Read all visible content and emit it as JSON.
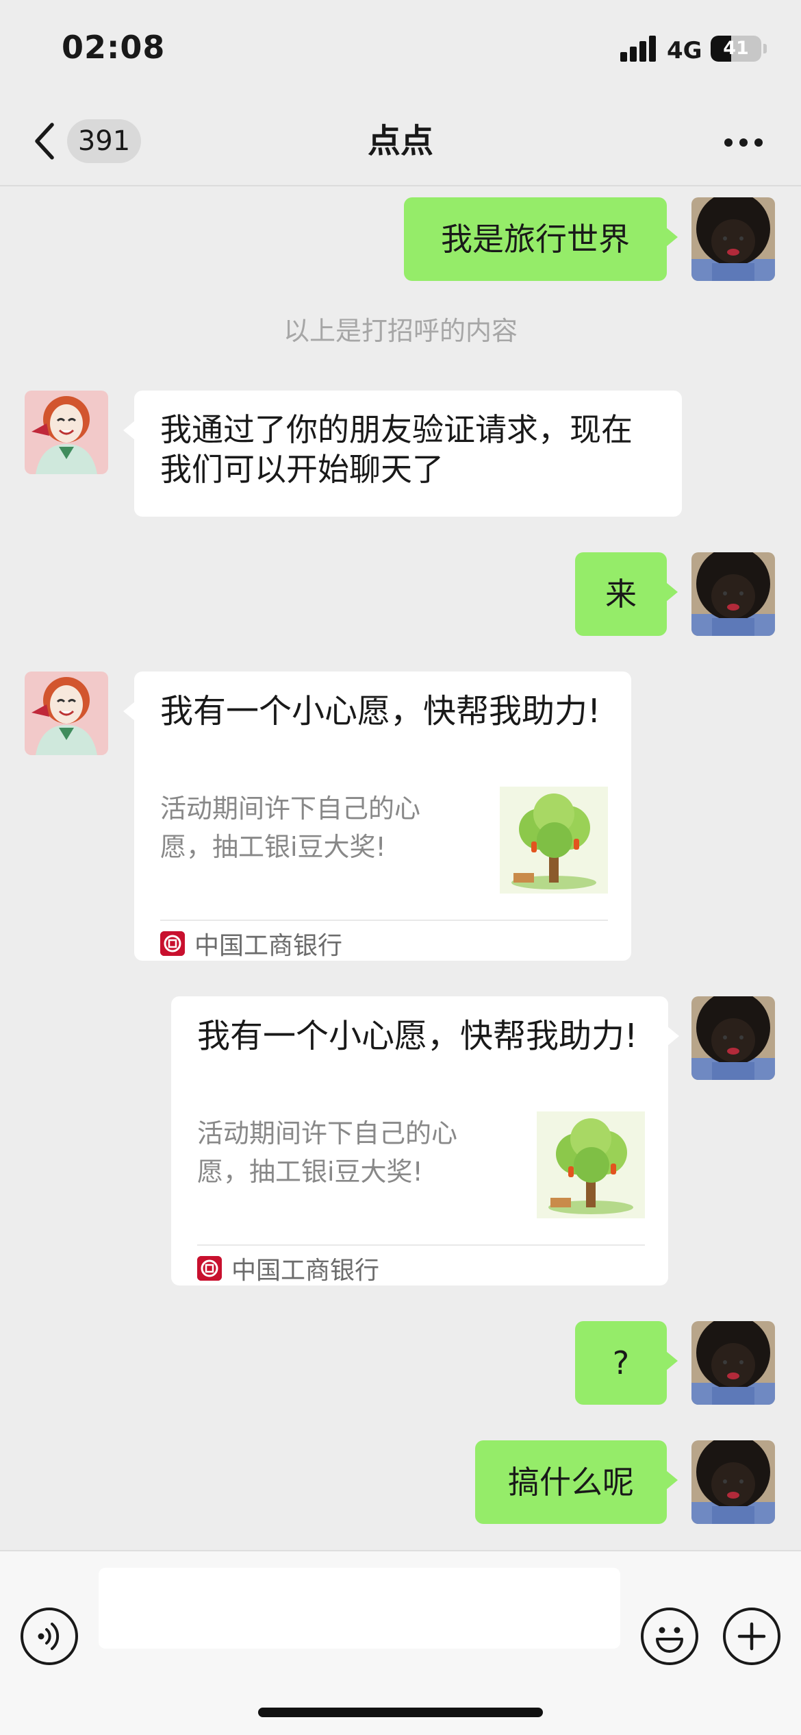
{
  "status_bar": {
    "time": "02:08",
    "network": "4G",
    "battery": "41",
    "battery_level": 0.41
  },
  "nav": {
    "unread_count": "391",
    "title": "点点"
  },
  "messages": {
    "m1": "我是旅行世界",
    "system_note": "以上是打招呼的内容",
    "m2": "我通过了你的朋友验证请求，现在我们可以开始聊天了",
    "m3": "来",
    "card1": {
      "title": "我有一个小心愿，快帮我助力!",
      "desc": "活动期间许下自己的心愿，抽工银i豆大奖!",
      "source": "中国工商银行"
    },
    "card2": {
      "title": "我有一个小心愿，快帮我助力!",
      "desc": "活动期间许下自己的心愿，抽工银i豆大奖!",
      "source": "中国工商银行"
    },
    "m4": "?",
    "m5": "搞什么呢"
  },
  "icons": {
    "back": "chevron-left-icon",
    "more": "more-dots-icon",
    "voice": "voice-icon",
    "emoji": "emoji-icon",
    "plus": "plus-icon",
    "card_thumbnail": "wish-tree-image",
    "card_source": "icbc-logo-icon"
  },
  "colors": {
    "background": "#ededed",
    "my_bubble": "#95ec69",
    "peer_bubble": "#ffffff",
    "icbc_red": "#c8102e"
  },
  "input": {
    "value": "",
    "placeholder": ""
  }
}
